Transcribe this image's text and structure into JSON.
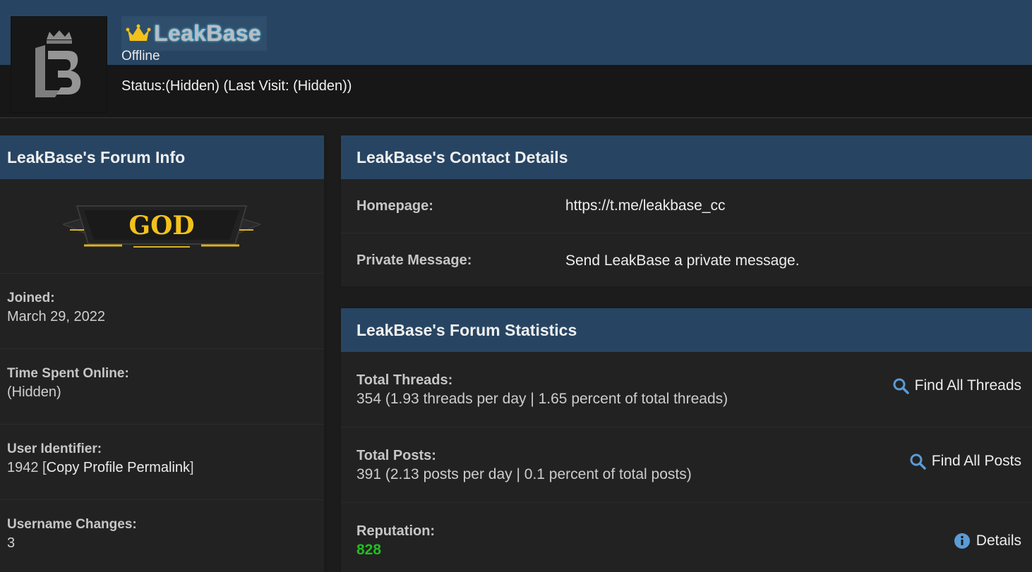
{
  "profile": {
    "username": "LeakBase",
    "online_status": "Offline",
    "status_line": "Status:(Hidden) (Last Visit: (Hidden))"
  },
  "forum_info": {
    "title": "LeakBase's Forum Info",
    "rank_text": "GOD",
    "joined_label": "Joined:",
    "joined_value": "March 29, 2022",
    "time_online_label": "Time Spent Online:",
    "time_online_value": "(Hidden)",
    "user_id_label": "User Identifier:",
    "user_id_value": "1942",
    "permalink_text": "Copy Profile Permalink",
    "username_changes_label": "Username Changes:",
    "username_changes_value": "3"
  },
  "contact": {
    "title": "LeakBase's Contact Details",
    "homepage_label": "Homepage:",
    "homepage_value": "https://t.me/leakbase_cc",
    "pm_label": "Private Message:",
    "pm_value": "Send LeakBase a private message."
  },
  "stats": {
    "title": "LeakBase's Forum Statistics",
    "threads_label": "Total Threads:",
    "threads_value": "354 (1.93 threads per day | 1.65 percent of total threads)",
    "threads_action": "Find All Threads",
    "posts_label": "Total Posts:",
    "posts_value": "391 (2.13 posts per day | 0.1 percent of total posts)",
    "posts_action": "Find All Posts",
    "reputation_label": "Reputation:",
    "reputation_value": "828",
    "reputation_action": "Details"
  },
  "colors": {
    "header_blue": "#274563",
    "reputation_green": "#1fbf1f",
    "crown_gold": "#f2c21b"
  }
}
